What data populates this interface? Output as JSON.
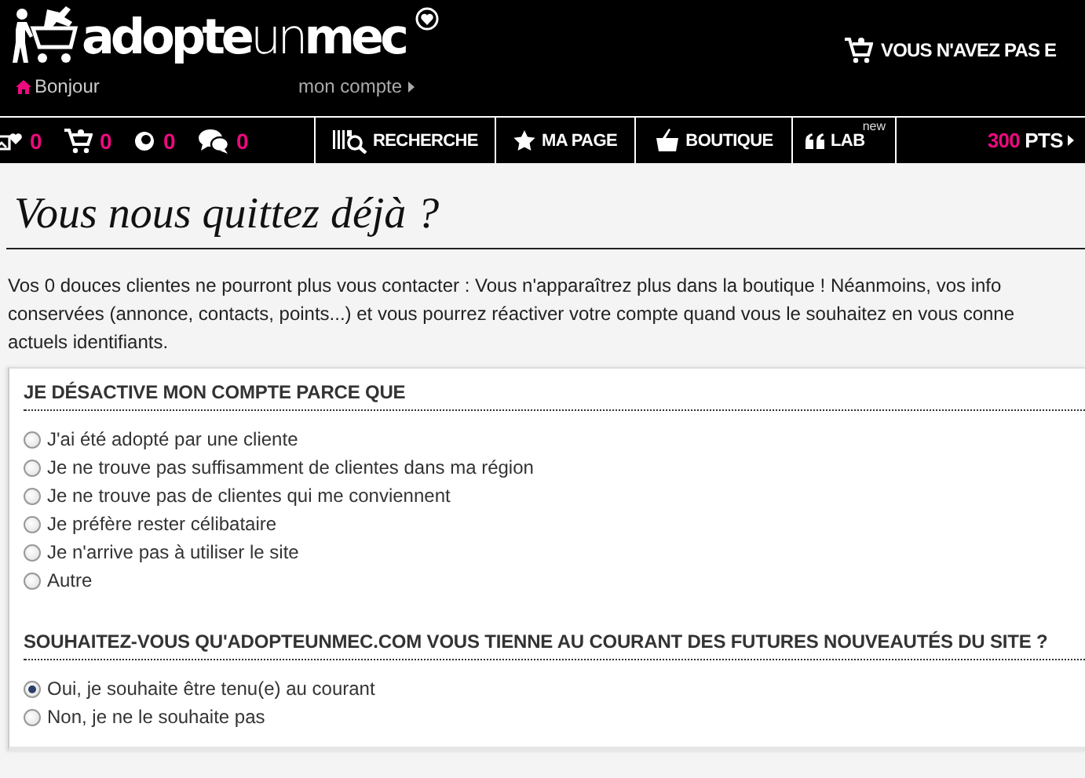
{
  "header": {
    "logo": "**adopte**un**mec**",
    "greeting": "Bonjour",
    "account_link": "mon compte",
    "cart_message": "VOUS N'AVEZ PAS E"
  },
  "nav": {
    "counters": [
      {
        "kind": "charms",
        "count": "0"
      },
      {
        "kind": "cart",
        "count": "0"
      },
      {
        "kind": "views",
        "count": "0"
      },
      {
        "kind": "messages",
        "count": "0"
      }
    ],
    "tabs": [
      {
        "kind": "search",
        "label": "RECHERCHE"
      },
      {
        "kind": "page",
        "label": "MA PAGE"
      },
      {
        "kind": "shop",
        "label": "BOUTIQUE"
      },
      {
        "kind": "lab",
        "label": "LAB",
        "badge": "new"
      }
    ],
    "points": {
      "value": "300",
      "unit": "PTS"
    }
  },
  "page": {
    "title": "Vous nous quittez déjà ?",
    "intro": [
      "Vos 0 douces clientes ne pourront plus vous contacter : Vous n'apparaîtrez plus dans la boutique ! Néanmoins, vos info",
      "conservées (annonce, contacts, points...) et vous pourrez réactiver votre compte quand vous le souhaitez en vous conne",
      "actuels identifiants."
    ],
    "sections": [
      {
        "title": "JE DÉSACTIVE MON COMPTE PARCE QUE",
        "options": [
          {
            "label": "J'ai été adopté par une cliente",
            "selected": false
          },
          {
            "label": "Je ne trouve pas suffisamment de clientes dans ma région",
            "selected": false
          },
          {
            "label": "Je ne trouve pas de clientes qui me conviennent",
            "selected": false
          },
          {
            "label": "Je préfère rester célibataire",
            "selected": false
          },
          {
            "label": "Je n'arrive pas à utiliser le site",
            "selected": false
          },
          {
            "label": "Autre",
            "selected": false
          }
        ]
      },
      {
        "title": "SOUHAITEZ-VOUS QU'ADOPTEUNMEC.COM VOUS TIENNE AU COURANT DES FUTURES NOUVEAUTÉS DU SITE ?",
        "options": [
          {
            "label": "Oui, je souhaite être tenu(e) au courant",
            "selected": true
          },
          {
            "label": "Non, je ne le souhaite pas",
            "selected": false
          }
        ]
      }
    ]
  }
}
